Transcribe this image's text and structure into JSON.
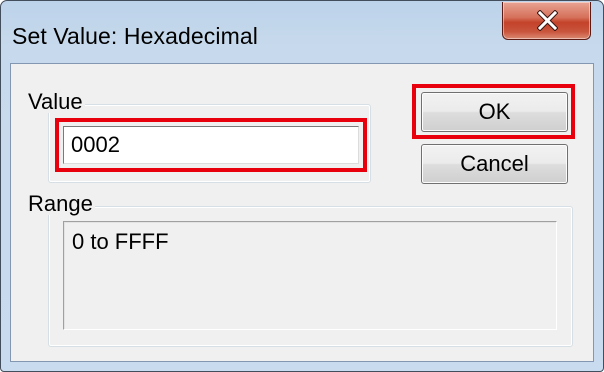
{
  "window": {
    "title": "Set Value: Hexadecimal",
    "close_icon": "close-x-icon"
  },
  "value_group": {
    "label": "Value",
    "input_value": "0002"
  },
  "range_group": {
    "label": "Range",
    "text": "0 to FFFF"
  },
  "buttons": {
    "ok_label": "OK",
    "cancel_label": "Cancel"
  },
  "colors": {
    "highlight": "#e8000d",
    "close_button": "#c4422a",
    "title_bar": "#c9dbee",
    "dialog_background": "#f0f0f0"
  }
}
